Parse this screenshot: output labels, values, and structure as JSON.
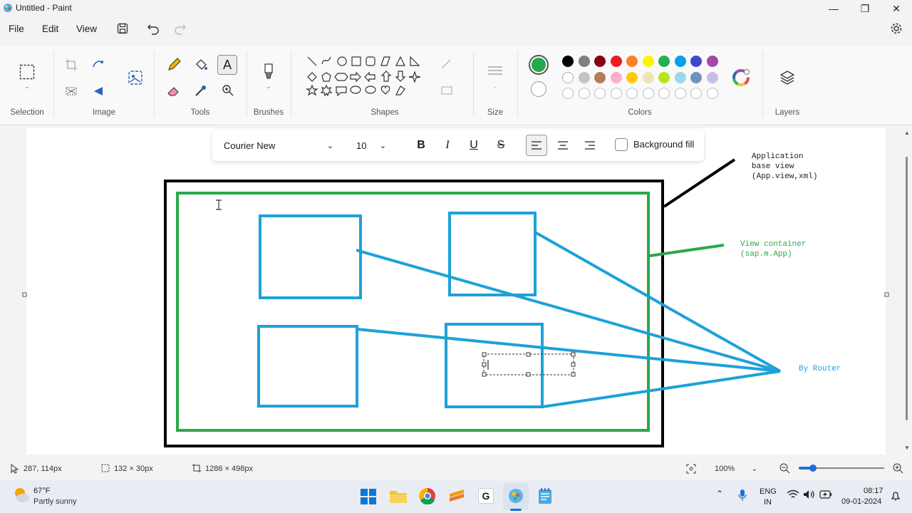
{
  "window": {
    "title": "Untitled - Paint",
    "minimize_glyph": "—",
    "maximize_glyph": "❐",
    "close_glyph": "✕"
  },
  "menu": {
    "file": "File",
    "edit": "Edit",
    "view": "View"
  },
  "ribbon": {
    "groups": {
      "selection": "Selection",
      "image": "Image",
      "tools": "Tools",
      "brushes": "Brushes",
      "shapes": "Shapes",
      "size": "Size",
      "colors": "Colors",
      "layers": "Layers"
    },
    "primary_color": "#22a94a",
    "secondary_color": "#ffffff",
    "palette_row1": [
      "#000000",
      "#7f7f7f",
      "#880015",
      "#ed1c24",
      "#ff7f27",
      "#fff200",
      "#22b14c",
      "#00a2e8",
      "#3f48cc",
      "#a349a4"
    ],
    "palette_row2": [
      "#ffffff",
      "#c3c3c3",
      "#b97a57",
      "#ffaec9",
      "#ffc90e",
      "#efe4b0",
      "#b5e61d",
      "#99d9ea",
      "#7092be",
      "#c8bfe7"
    ],
    "palette_row3_count_label": ""
  },
  "textbar": {
    "font": "Courier New",
    "size": "10",
    "bold": "B",
    "italic": "I",
    "underline": "U",
    "strike": "S",
    "background_fill": "Background fill"
  },
  "drawing": {
    "annotation_app": [
      "Application",
      "base view",
      "(App.view,xml)"
    ],
    "annotation_container": [
      "View container",
      "(sap.m.App)"
    ],
    "annotation_router": "By Router",
    "colors": {
      "black": "#000000",
      "green": "#2aa84a",
      "blue": "#1ea1d8"
    }
  },
  "status": {
    "cursor": "287, 114px",
    "selection": "132 × 30px",
    "canvas_size": "1286 × 498px",
    "zoom": "100%"
  },
  "taskbar": {
    "weather_temp": "67°F",
    "weather_desc": "Partly sunny",
    "lang1": "ENG",
    "lang2": "IN",
    "time": "08:17",
    "date": "09-01-2024"
  }
}
